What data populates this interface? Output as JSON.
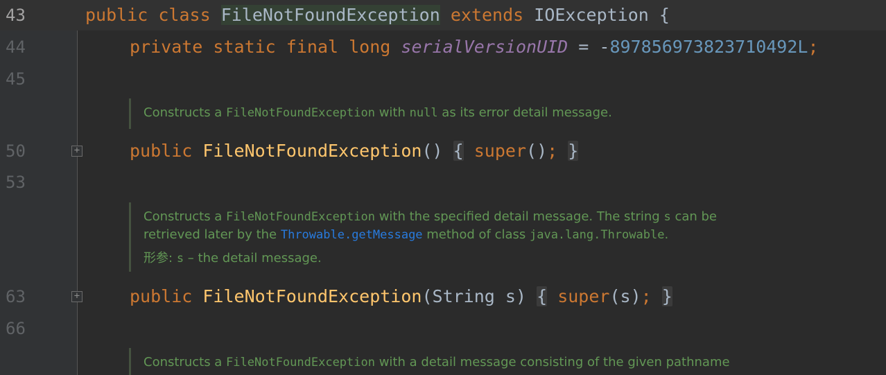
{
  "line_numbers": [
    "43",
    "44",
    "45",
    "50",
    "53",
    "63",
    "66"
  ],
  "line43": {
    "kw_public": "public",
    "kw_class": "class",
    "class_name": "FileNotFoundException",
    "kw_extends": "extends",
    "super_class": "IOException",
    "brace": "{"
  },
  "line44": {
    "kw_private": "private",
    "kw_static": "static",
    "kw_final": "final",
    "kw_long": "long",
    "field": "serialVersionUID",
    "eq": "=",
    "minus": "-",
    "value": "897856973823710492L",
    "semi": ";"
  },
  "doc1": {
    "t1": "Constructs a ",
    "c1": "FileNotFoundException",
    "t2": " with ",
    "c2": "null",
    "t3": " as its error detail message."
  },
  "line50": {
    "kw_public": "public",
    "ctor": "FileNotFoundException",
    "parens": "()",
    "open": "{",
    "kw_super": "super",
    "call": "()",
    "semi": ";",
    "close": "}"
  },
  "doc2": {
    "l1_t1": "Constructs a ",
    "l1_c1": "FileNotFoundException",
    "l1_t2": " with the specified detail message. The string ",
    "l1_c2": "s",
    "l1_t3": " can be",
    "l2_t1": "retrieved later by the ",
    "l2_link": "Throwable.getMessage",
    "l2_t2": " method of class ",
    "l2_c1": "java.lang.Throwable",
    "l2_t3": ".",
    "param_label": "形参:",
    "param_name": "s",
    "param_desc": " – the detail message."
  },
  "line63": {
    "kw_public": "public",
    "ctor": "FileNotFoundException",
    "open_paren": "(",
    "type": "String",
    "arg": "s",
    "close_paren": ")",
    "open": "{",
    "kw_super": "super",
    "call": "(s)",
    "semi": ";",
    "close": "}"
  },
  "doc3": {
    "t1": "Constructs a ",
    "c1": "FileNotFoundException",
    "t2": " with a detail message consisting of the given pathname"
  },
  "colors": {
    "background": "#2b2b2b",
    "keyword": "#cc7832",
    "method": "#ffc66d",
    "field": "#9876aa",
    "number": "#6897bb",
    "doc": "#629755",
    "link": "#287bde"
  }
}
